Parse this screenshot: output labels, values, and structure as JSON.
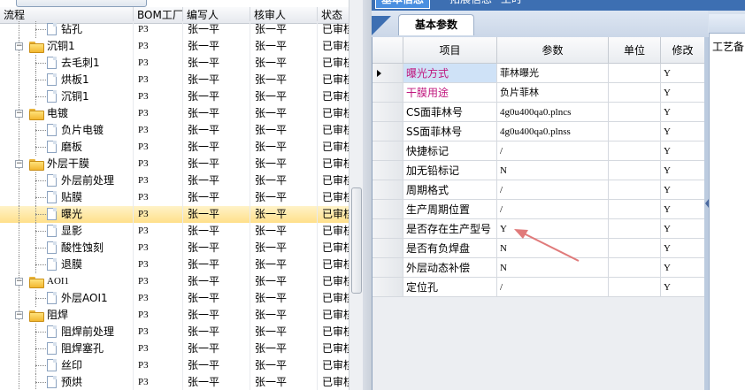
{
  "left_grid": {
    "top_button": "",
    "headers": [
      "流程",
      "BOM工厂",
      "编写人",
      "核审人",
      "状态"
    ],
    "rows": [
      {
        "name": "钻孔",
        "level": 2,
        "type": "doc",
        "bom": "P3",
        "writer": "张一平",
        "reviewer": "张一平",
        "status": "已审核"
      },
      {
        "name": "沉铜1",
        "level": 1,
        "type": "folder",
        "bom": "P3",
        "writer": "张一平",
        "reviewer": "张一平",
        "status": "已审核"
      },
      {
        "name": "去毛刺1",
        "level": 2,
        "type": "doc",
        "bom": "P3",
        "writer": "张一平",
        "reviewer": "张一平",
        "status": "已审核"
      },
      {
        "name": "烘板1",
        "level": 2,
        "type": "doc",
        "bom": "P3",
        "writer": "张一平",
        "reviewer": "张一平",
        "status": "已审核"
      },
      {
        "name": "沉铜1",
        "level": 2,
        "type": "doc",
        "bom": "P3",
        "writer": "张一平",
        "reviewer": "张一平",
        "status": "已审核"
      },
      {
        "name": "电镀",
        "level": 1,
        "type": "folder",
        "bom": "P3",
        "writer": "张一平",
        "reviewer": "张一平",
        "status": "已审核"
      },
      {
        "name": "负片电镀",
        "level": 2,
        "type": "doc",
        "bom": "P3",
        "writer": "张一平",
        "reviewer": "张一平",
        "status": "已审核"
      },
      {
        "name": "磨板",
        "level": 2,
        "type": "doc",
        "bom": "P3",
        "writer": "张一平",
        "reviewer": "张一平",
        "status": "已审核"
      },
      {
        "name": "外层干膜",
        "level": 1,
        "type": "folder",
        "bom": "P3",
        "writer": "张一平",
        "reviewer": "张一平",
        "status": "已审核"
      },
      {
        "name": "外层前处理",
        "level": 2,
        "type": "doc",
        "bom": "P3",
        "writer": "张一平",
        "reviewer": "张一平",
        "status": "已审核"
      },
      {
        "name": "贴膜",
        "level": 2,
        "type": "doc",
        "bom": "P3",
        "writer": "张一平",
        "reviewer": "张一平",
        "status": "已审核"
      },
      {
        "name": "曝光",
        "level": 2,
        "type": "doc",
        "bom": "P3",
        "writer": "张一平",
        "reviewer": "张一平",
        "status": "已审核",
        "selected": true
      },
      {
        "name": "显影",
        "level": 2,
        "type": "doc",
        "bom": "P3",
        "writer": "张一平",
        "reviewer": "张一平",
        "status": "已审核"
      },
      {
        "name": "酸性蚀刻",
        "level": 2,
        "type": "doc",
        "bom": "P3",
        "writer": "张一平",
        "reviewer": "张一平",
        "status": "已审核"
      },
      {
        "name": "退膜",
        "level": 2,
        "type": "doc",
        "bom": "P3",
        "writer": "张一平",
        "reviewer": "张一平",
        "status": "已审核"
      },
      {
        "name": "AOI1",
        "level": 1,
        "type": "folder",
        "bom": "P3",
        "writer": "张一平",
        "reviewer": "张一平",
        "status": "已审核"
      },
      {
        "name": "外层AOI1",
        "level": 2,
        "type": "doc",
        "bom": "P3",
        "writer": "张一平",
        "reviewer": "张一平",
        "status": "已审核"
      },
      {
        "name": "阻焊",
        "level": 1,
        "type": "folder",
        "bom": "P3",
        "writer": "张一平",
        "reviewer": "张一平",
        "status": "已审核"
      },
      {
        "name": "阻焊前处理",
        "level": 2,
        "type": "doc",
        "bom": "P3",
        "writer": "张一平",
        "reviewer": "张一平",
        "status": "已审核"
      },
      {
        "name": "阻焊塞孔",
        "level": 2,
        "type": "doc",
        "bom": "P3",
        "writer": "张一平",
        "reviewer": "张一平",
        "status": "已审核"
      },
      {
        "name": "丝印",
        "level": 2,
        "type": "doc",
        "bom": "P3",
        "writer": "张一平",
        "reviewer": "张一平",
        "status": "已审核"
      },
      {
        "name": "预烘",
        "level": 2,
        "type": "doc",
        "bom": "P3",
        "writer": "张一平",
        "reviewer": "张一平",
        "status": "已审核"
      }
    ]
  },
  "top_tabs": [
    "基本信息",
    "拓展信息",
    "工时"
  ],
  "inner_tab": "基本参数",
  "param_grid": {
    "headers": [
      "项目",
      "参数",
      "单位",
      "修改"
    ],
    "rows": [
      {
        "item": "曝光方式",
        "value": "菲林曝光",
        "unit": "",
        "modify": "Y",
        "pink": true,
        "current": true
      },
      {
        "item": "干膜用途",
        "value": "负片菲林",
        "unit": "",
        "modify": "Y",
        "pink": true
      },
      {
        "item": "CS面菲林号",
        "value": "4g0u400qa0.plncs",
        "unit": "",
        "modify": "Y"
      },
      {
        "item": "SS面菲林号",
        "value": "4g0u400qa0.plnss",
        "unit": "",
        "modify": "Y"
      },
      {
        "item": "快捷标记",
        "value": "/",
        "unit": "",
        "modify": "Y"
      },
      {
        "item": "加无铅标记",
        "value": "N",
        "unit": "",
        "modify": "Y"
      },
      {
        "item": "周期格式",
        "value": "/",
        "unit": "",
        "modify": "Y"
      },
      {
        "item": "生产周期位置",
        "value": "/",
        "unit": "",
        "modify": "Y"
      },
      {
        "item": "是否存在生产型号",
        "value": "Y",
        "unit": "",
        "modify": "Y"
      },
      {
        "item": "是否有负焊盘",
        "value": "N",
        "unit": "",
        "modify": "Y"
      },
      {
        "item": "外层动态补偿",
        "value": "N",
        "unit": "",
        "modify": "Y"
      },
      {
        "item": "定位孔",
        "value": "/",
        "unit": "",
        "modify": "Y"
      }
    ]
  },
  "far_right": {
    "label": "工艺备"
  },
  "colors": {
    "accent": "#3d6fb2",
    "selected_row": "#ffe08a",
    "pink_text": "#c0177e",
    "arrow": "#e07a7a"
  },
  "icons": [
    "folder-icon",
    "document-icon",
    "expander-minus-icon",
    "row-indicator-icon",
    "annotation-arrow"
  ]
}
